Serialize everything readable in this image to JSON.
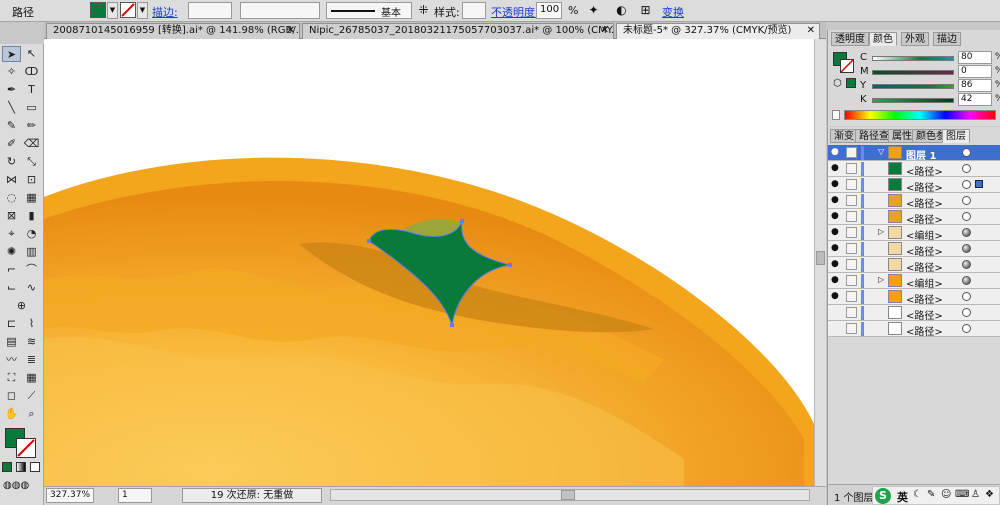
{
  "control_bar": {
    "selection_label": "路径",
    "fill_color": "#0a7a3c",
    "stroke_label": "描边:",
    "stroke_weight": "",
    "brush_label": "基本",
    "style_label": "样式:",
    "opacity_label": "不透明度:",
    "opacity_value": "100",
    "opacity_unit": "%",
    "transform_label": "变换"
  },
  "tabs": [
    {
      "label": "2008710145016959 [转换].ai* @ 141.98% (RGB/...",
      "close": "✕"
    },
    {
      "label": "Nipic_26785037_20180321175057703037.ai* @ 100% (CMY...",
      "close": "✕"
    },
    {
      "label": "未标题-5* @ 327.37% (CMYK/预览)",
      "close": "✕"
    }
  ],
  "colors": {
    "orange_light": "#f9c23a",
    "orange_dark": "#e08a10",
    "stem_green": "#0a7a3c",
    "selection_blue": "#3f6fce"
  },
  "color_panel": {
    "tabs": [
      "透明度",
      "颜色",
      "外观",
      "描边"
    ],
    "channels": [
      {
        "name": "C",
        "value": "80",
        "unit": "%"
      },
      {
        "name": "M",
        "value": "0",
        "unit": "%"
      },
      {
        "name": "Y",
        "value": "86",
        "unit": "%"
      },
      {
        "name": "K",
        "value": "42",
        "unit": "%"
      }
    ]
  },
  "layers_panel": {
    "tabs": [
      "渐变",
      "路径查",
      "属性",
      "颜色参",
      "图层"
    ],
    "layer_name": "图层 1",
    "items": [
      {
        "name": "<路径>",
        "thumb": "#0a7a3c",
        "expand": "",
        "target": "empty"
      },
      {
        "name": "<路径>",
        "thumb": "#0a7a3c",
        "expand": "",
        "target": "ring"
      },
      {
        "name": "<路径>",
        "thumb": "#e8a030",
        "expand": "",
        "target": "empty"
      },
      {
        "name": "<路径>",
        "thumb": "#e8a030",
        "expand": "",
        "target": "empty"
      },
      {
        "name": "<编组>",
        "thumb": "#f3d9a5",
        "expand": "▷",
        "target": "fill"
      },
      {
        "name": "<路径>",
        "thumb": "#f3d9a5",
        "expand": "",
        "target": "fill"
      },
      {
        "name": "<路径>",
        "thumb": "#f3d9a5",
        "expand": "",
        "target": "fill"
      },
      {
        "name": "<编组>",
        "thumb": "#f2a20c",
        "expand": "▷",
        "target": "fill"
      },
      {
        "name": "<路径>",
        "thumb": "#f2a20c",
        "expand": "",
        "target": "empty"
      },
      {
        "name": "<路径>",
        "thumb": "#ffffff",
        "expand": "",
        "target": "empty"
      },
      {
        "name": "<路径>",
        "thumb": "#ffffff",
        "expand": "",
        "target": "empty"
      }
    ],
    "footer": "1 个图层"
  },
  "status_bar": {
    "zoom": "327.37%",
    "artboard": "1",
    "undo_text": "19 次还原: 无重做"
  },
  "ime": {
    "lang": "英"
  }
}
